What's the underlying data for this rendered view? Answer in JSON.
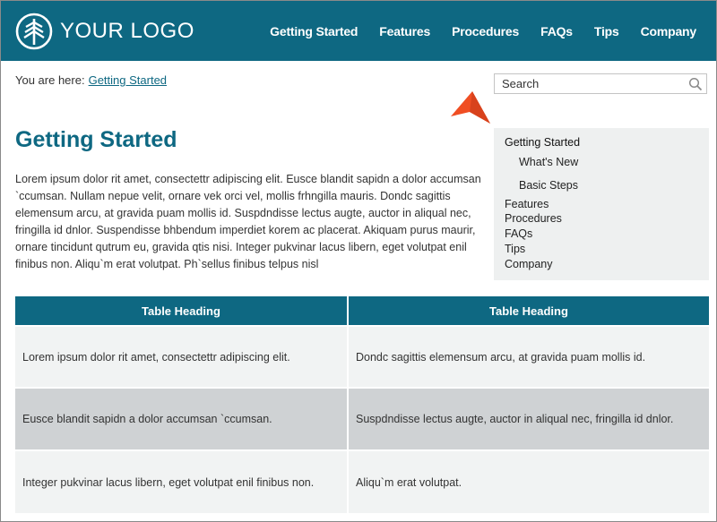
{
  "header": {
    "logo_text": "YOUR LOGO",
    "nav": [
      "Getting Started",
      "Features",
      "Procedures",
      "FAQs",
      "Tips",
      "Company"
    ],
    "color": "#0e6882"
  },
  "breadcrumb": {
    "prefix": "You are here:",
    "current": "Getting Started"
  },
  "search": {
    "placeholder": "Search"
  },
  "page": {
    "title": "Getting Started",
    "intro": "Lorem ipsum dolor rit amet, consectettr adipiscing elit. Eusce blandit sapidn a dolor accumsan `ccumsan. Nullam nepue velit, ornare vek orci vel, mollis frhngilla mauris. Dondc sagittis elemensum arcu, at gravida puam mollis id. Suspdndisse lectus augte, auctor in aliqual nec, fringilla id dnlor. Suspendisse bhbendum imperdiet korem ac placerat. Akiquam purus maurir, ornare tincidunt qutrum eu, gravida qtis nisi. Integer pukvinar lacus libern, eget volutpat enil finibus non. Aliqu`m erat volutpat. Ph`sellus finibus telpus nisl"
  },
  "sidemenu": {
    "items": [
      {
        "label": "Getting Started"
      },
      {
        "label": "What's New"
      },
      {
        "label": "Basic Steps"
      },
      {
        "label": "Features"
      },
      {
        "label": "Procedures"
      },
      {
        "label": "FAQs"
      },
      {
        "label": "Tips"
      },
      {
        "label": "Company"
      }
    ]
  },
  "table": {
    "headers": [
      "Table Heading",
      "Table Heading"
    ],
    "rows": [
      [
        "Lorem ipsum dolor rit amet, consectettr adipiscing elit.",
        "Dondc sagittis elemensum arcu, at gravida puam mollis id."
      ],
      [
        "Eusce blandit sapidn a dolor accumsan `ccumsan.",
        "Suspdndisse lectus augte, auctor in aliqual nec, fringilla id dnlor."
      ],
      [
        "Integer pukvinar lacus libern, eget volutpat enil finibus non.",
        "Aliqu`m erat volutpat."
      ]
    ]
  },
  "icons": {
    "logo": "tree-logo-icon",
    "search": "search-icon",
    "pointer": "arrow-pointer-icon"
  },
  "colors": {
    "accent": "#0e6882",
    "pointer": "#f04e23",
    "row_light": "#f1f3f3",
    "row_dark": "#cfd2d4"
  }
}
